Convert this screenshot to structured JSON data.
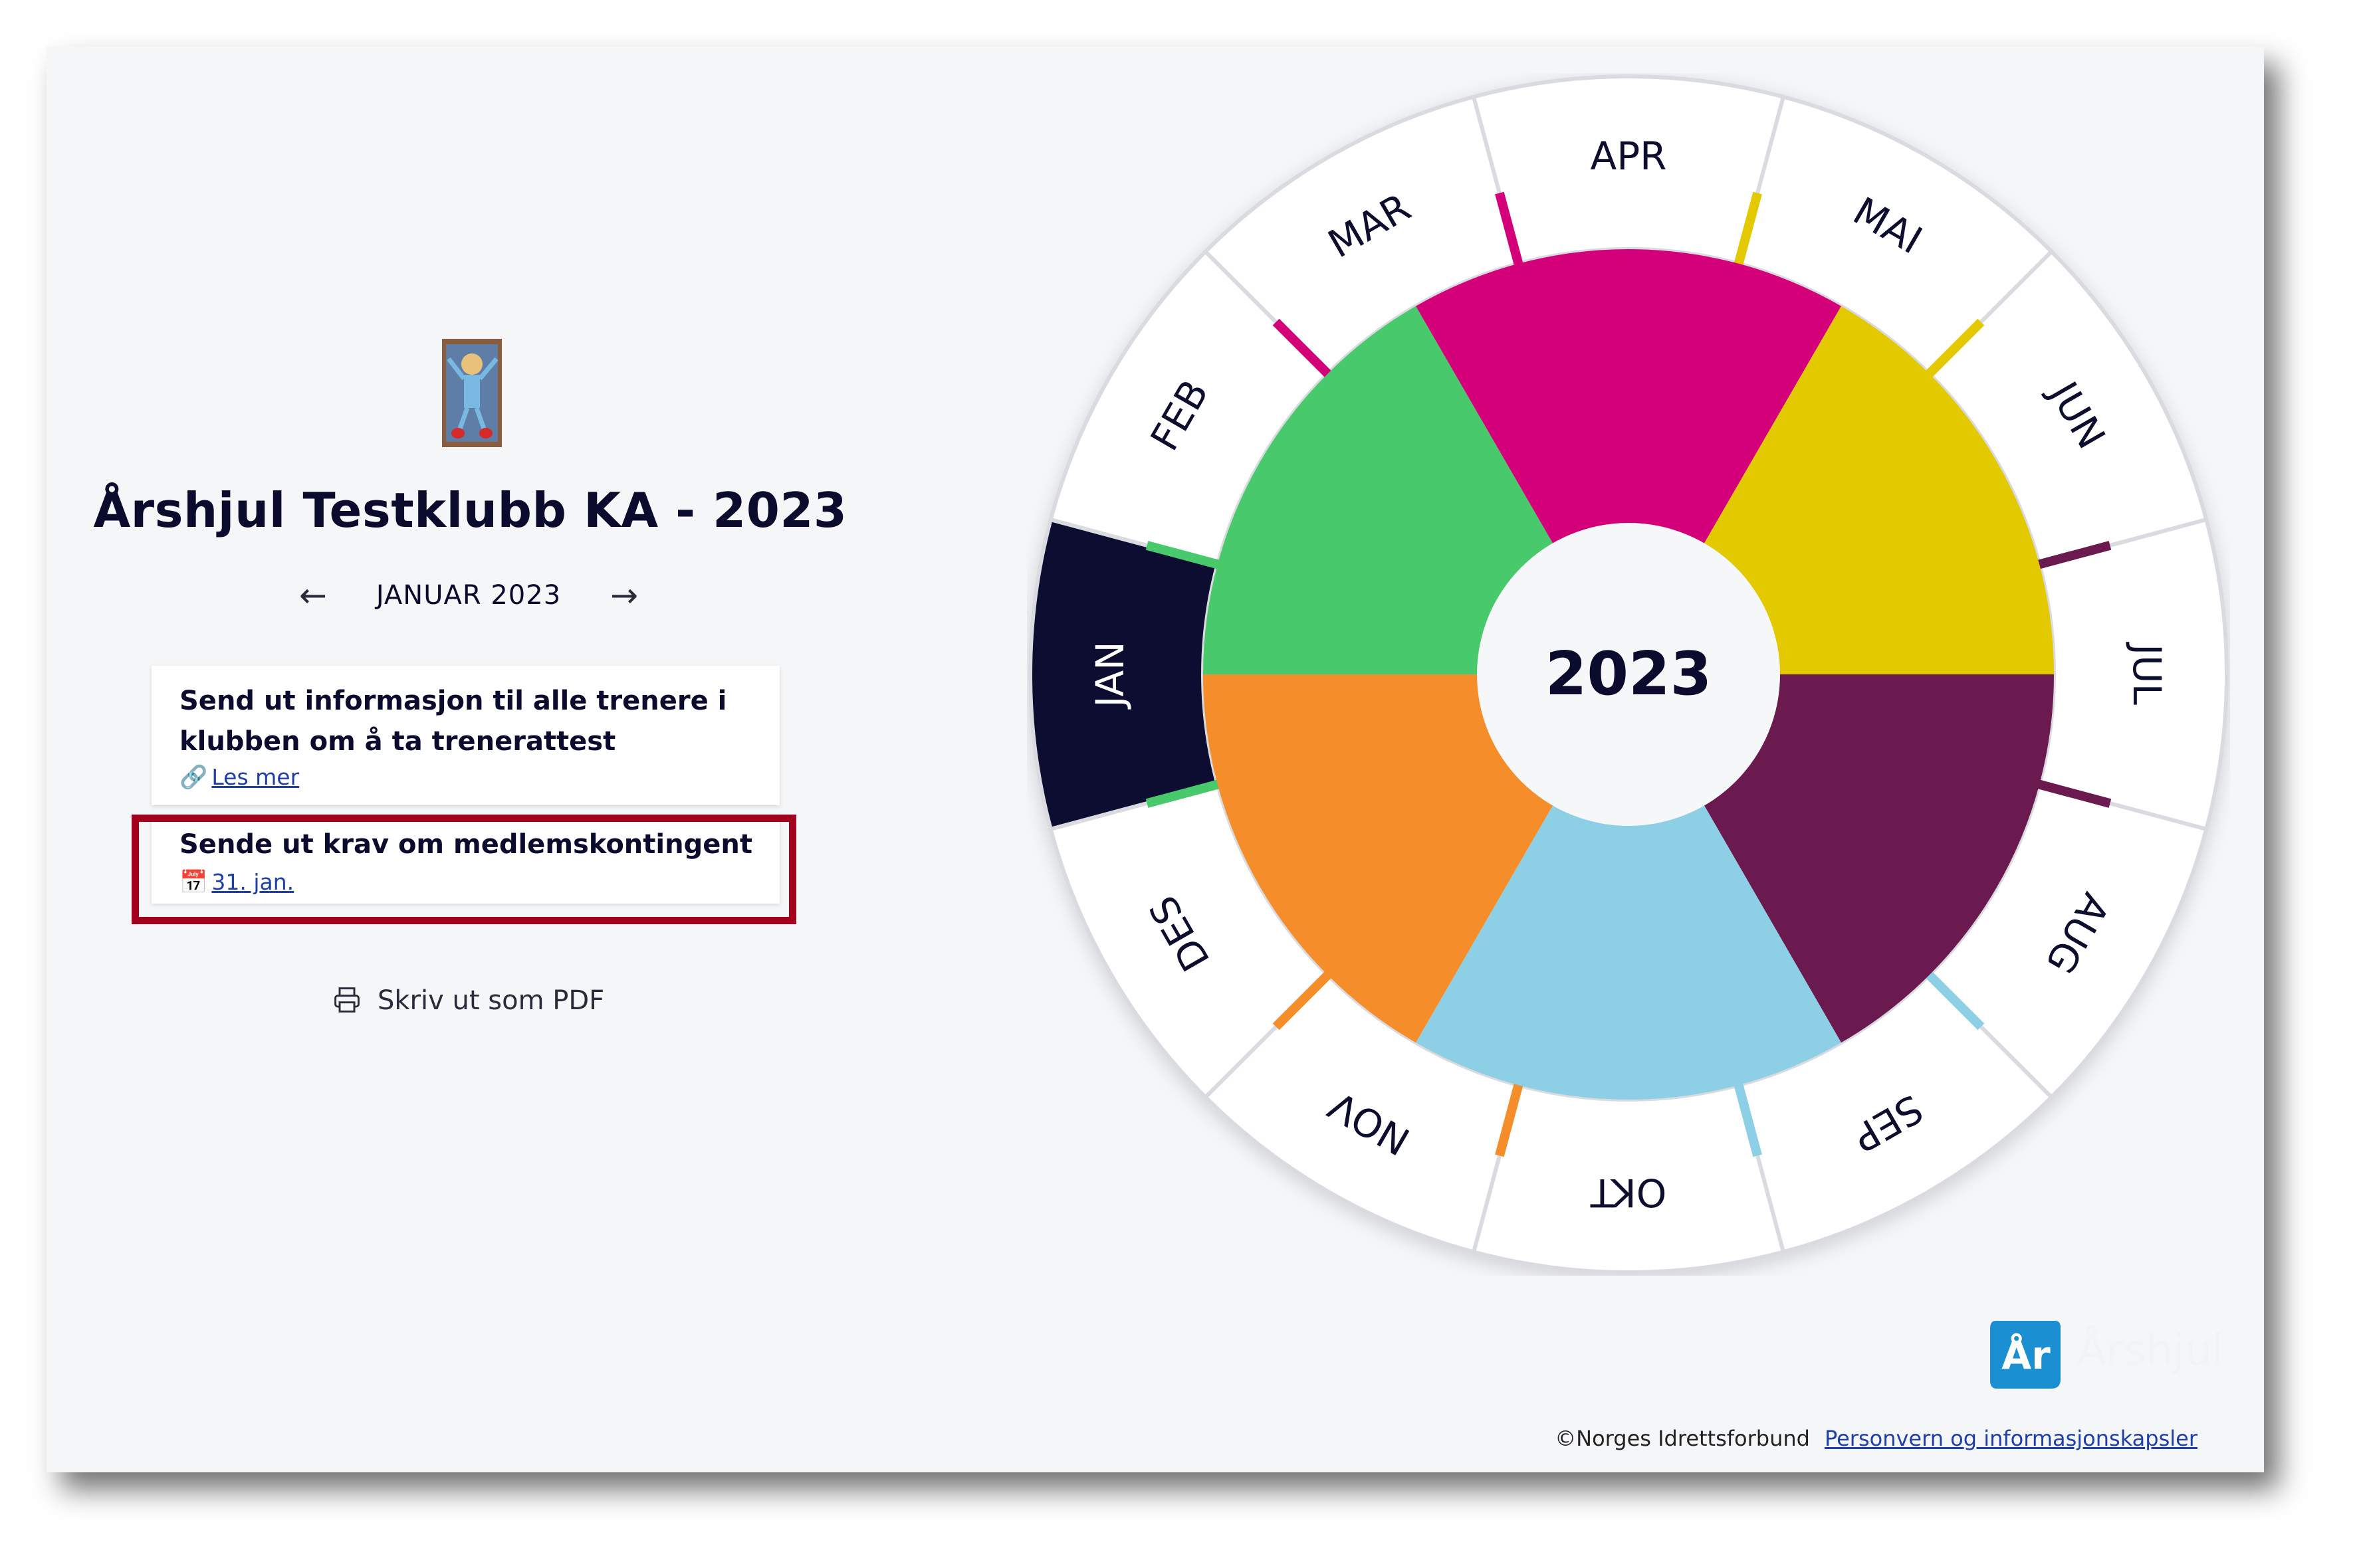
{
  "club": {
    "title": "Årshjul Testklubb KA - 2023",
    "logo_icon": "club-logo-image"
  },
  "month_nav": {
    "prev_icon": "arrow-left-icon",
    "next_icon": "arrow-right-icon",
    "prev_glyph": "←",
    "next_glyph": "→",
    "current_label": "JANUAR 2023"
  },
  "activities": [
    {
      "line1": "Send ut informasjon til alle trenere i",
      "line2": "klubben om å ta trenerattest",
      "link_icon": "link-icon",
      "link_label": "Les mer"
    },
    {
      "line1": "Sende ut krav om medlemskontingent",
      "date_icon": "calendar-icon",
      "date_label": "31. jan."
    }
  ],
  "print": {
    "icon": "printer-icon",
    "label": "Skriv ut som PDF"
  },
  "wheel": {
    "year": "2023",
    "selected_month": "JAN",
    "months": [
      "JAN",
      "FEB",
      "MAR",
      "APR",
      "MAI",
      "JUN",
      "JUL",
      "AUG",
      "SEP",
      "OKT",
      "NOV",
      "DES"
    ],
    "quarter_colors": [
      "#48c96b",
      "#d4007a",
      "#e2c900",
      "#6b1a50",
      "#8dd0e6",
      "#f58e2a"
    ],
    "selected_color": "#0a0a33"
  },
  "brand": {
    "icon_text": "År",
    "name": "Årshjul",
    "color": "#1a8fd1"
  },
  "footer": {
    "copyright": "©Norges Idrettsforbund",
    "privacy_link": "Personvern og informasjonskapsler"
  }
}
